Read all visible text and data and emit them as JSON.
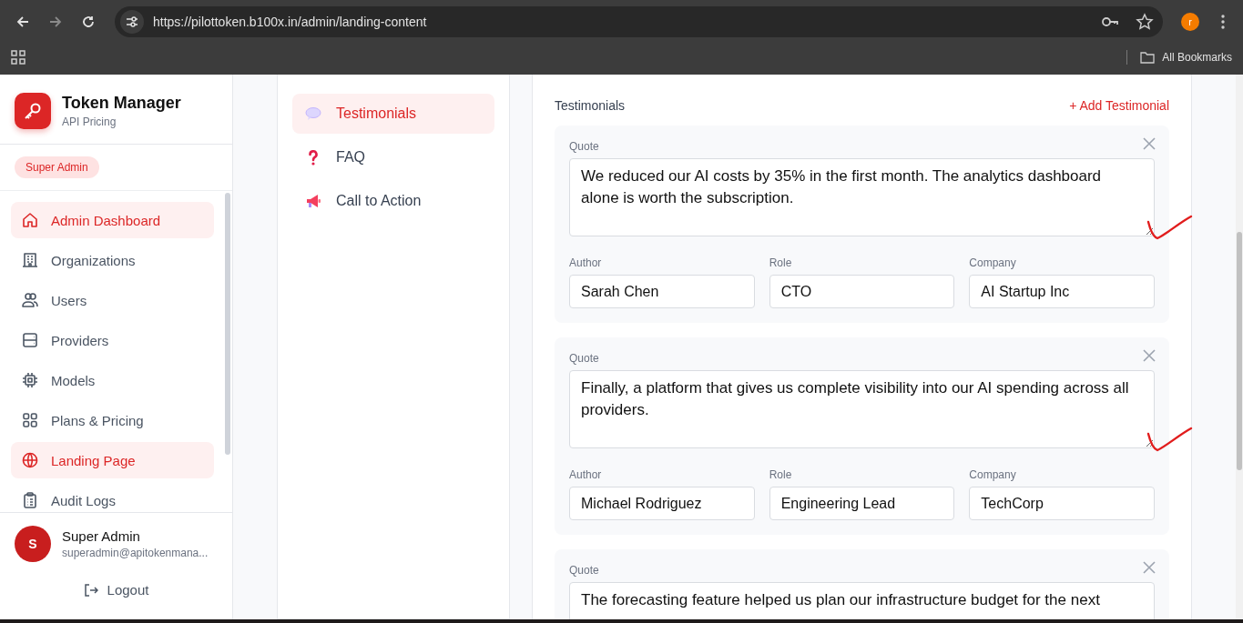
{
  "browser": {
    "url": "https://pilottoken.b100x.in/admin/landing-content",
    "profile_initial": "r",
    "bookmarks_label": "All Bookmarks"
  },
  "sidebar": {
    "brand": {
      "title": "Token Manager",
      "subtitle": "API Pricing"
    },
    "role_badge": "Super Admin",
    "items": [
      {
        "label": "Admin Dashboard",
        "selected": true
      },
      {
        "label": "Organizations",
        "selected": false
      },
      {
        "label": "Users",
        "selected": false
      },
      {
        "label": "Providers",
        "selected": false
      },
      {
        "label": "Models",
        "selected": false
      },
      {
        "label": "Plans & Pricing",
        "selected": false
      },
      {
        "label": "Landing Page",
        "selected": true
      },
      {
        "label": "Audit Logs",
        "selected": false
      }
    ],
    "user": {
      "initial": "S",
      "name": "Super Admin",
      "email": "superadmin@apitokenmana..."
    },
    "logout": "Logout"
  },
  "section_nav": {
    "items": [
      {
        "label": "Testimonials",
        "selected": true
      },
      {
        "label": "FAQ",
        "selected": false
      },
      {
        "label": "Call to Action",
        "selected": false
      }
    ]
  },
  "testimonials": {
    "title": "Testimonials",
    "add_label": "+ Add Testimonial",
    "items": [
      {
        "quote_label": "Quote",
        "quote": "We reduced our AI costs by 35% in the first month. The analytics dashboard alone is worth the subscription.",
        "author_label": "Author",
        "author": "Sarah Chen",
        "role_label": "Role",
        "role": "CTO",
        "company_label": "Company",
        "company": "AI Startup Inc",
        "annotated": true
      },
      {
        "quote_label": "Quote",
        "quote": "Finally, a platform that gives us complete visibility into our AI spending across all providers.",
        "author_label": "Author",
        "author": "Michael Rodriguez",
        "role_label": "Role",
        "role": "Engineering Lead",
        "company_label": "Company",
        "company": "TechCorp",
        "annotated": true
      },
      {
        "quote_label": "Quote",
        "quote": "The forecasting feature helped us plan our infrastructure budget for the next",
        "annotated": false
      }
    ]
  }
}
